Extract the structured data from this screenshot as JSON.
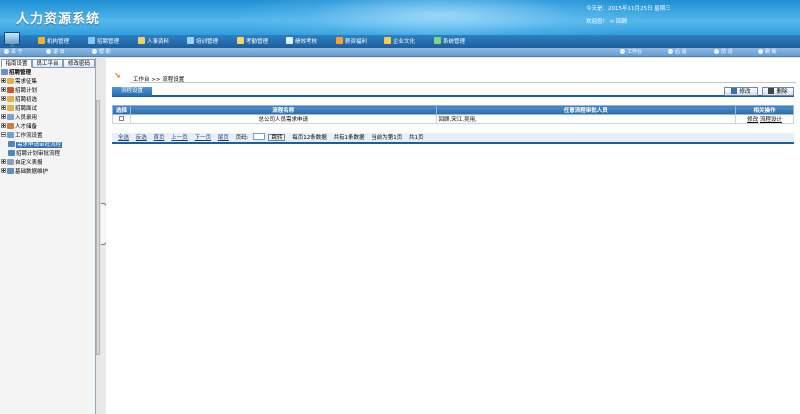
{
  "header": {
    "title": "人力资源系统",
    "date_text": "今天是：2015年11月25日 星期三",
    "welcome_text": "欢迎您！ > 回顾"
  },
  "menu": [
    {
      "label": "机构管理",
      "color": "#f2b234"
    },
    {
      "label": "招聘管理",
      "color": "#8ac6ff"
    },
    {
      "label": "人事资料",
      "color": "#f1d26a"
    },
    {
      "label": "培训管理",
      "color": "#9fd3ff"
    },
    {
      "label": "考勤管理",
      "color": "#ffd36b"
    },
    {
      "label": "绩效考核",
      "color": "#e2efff"
    },
    {
      "label": "薪资福利",
      "color": "#ff9f2e"
    },
    {
      "label": "企业文化",
      "color": "#ffc94a"
    },
    {
      "label": "系统管理",
      "color": "#7ed87e"
    }
  ],
  "subbar": {
    "left": [
      "关 于",
      "退 出",
      "帮 助"
    ],
    "right": [
      "工作台",
      "后 退",
      "前 进",
      "刷 新"
    ]
  },
  "left_panel": {
    "tabs": [
      "指南设置",
      "员工平台",
      "修改密码"
    ],
    "tree": [
      {
        "label": "招聘管理",
        "icon_color": "#6b8fc8",
        "level": 0,
        "expander": "",
        "root": true
      },
      {
        "label": "需求征集",
        "icon_color": "#e2b24a",
        "level": 1,
        "expander": "plus"
      },
      {
        "label": "招聘计划",
        "icon_color": "#c25a2f",
        "level": 1,
        "expander": "plus"
      },
      {
        "label": "招聘初选",
        "icon_color": "#e2b24a",
        "level": 1,
        "expander": "plus"
      },
      {
        "label": "招聘面试",
        "icon_color": "#e2b24a",
        "level": 1,
        "expander": "plus"
      },
      {
        "label": "入员录用",
        "icon_color": "#7aa3d8",
        "level": 1,
        "expander": "plus"
      },
      {
        "label": "人才储备",
        "icon_color": "#cf7b39",
        "level": 1,
        "expander": "plus"
      },
      {
        "label": "工作流设置",
        "icon_color": "#6fa0d8",
        "level": 1,
        "expander": "minus"
      },
      {
        "label": "需求申请审批流程",
        "icon_color": "#4f86c6",
        "level": 2,
        "expander": "",
        "selected": true
      },
      {
        "label": "招聘计划审批流程",
        "icon_color": "#4f86c6",
        "level": 2,
        "expander": ""
      },
      {
        "label": "自定义表报",
        "icon_color": "#8aa0b8",
        "level": 1,
        "expander": "plus"
      },
      {
        "label": "基础数据维护",
        "icon_color": "#5e8fc4",
        "level": 1,
        "expander": "plus"
      }
    ]
  },
  "content": {
    "breadcrumb": "工作台 >> 流程设置",
    "section_tab": "流程设置",
    "buttons": {
      "edit": "修改",
      "delete": "删除"
    },
    "table": {
      "headers": [
        "选择",
        "流程名称",
        "任意流程审批人员",
        "相关操作"
      ],
      "rows": [
        {
          "name": "总公司人员需求申请",
          "approvers": "回顾,宋江,吴用,",
          "ops": [
            "修改",
            "流程设计"
          ]
        }
      ]
    },
    "pager": {
      "select_all": "全选",
      "invert": "反选",
      "first": "首页",
      "prev": "上一页",
      "next": "下一页",
      "last": "尾页",
      "page_jump_label": "页码:",
      "go": "跳转",
      "per_page": "每页12条数据",
      "total": "共有1条数据",
      "current": "当前为第1页",
      "total_pages": "共1页"
    }
  }
}
